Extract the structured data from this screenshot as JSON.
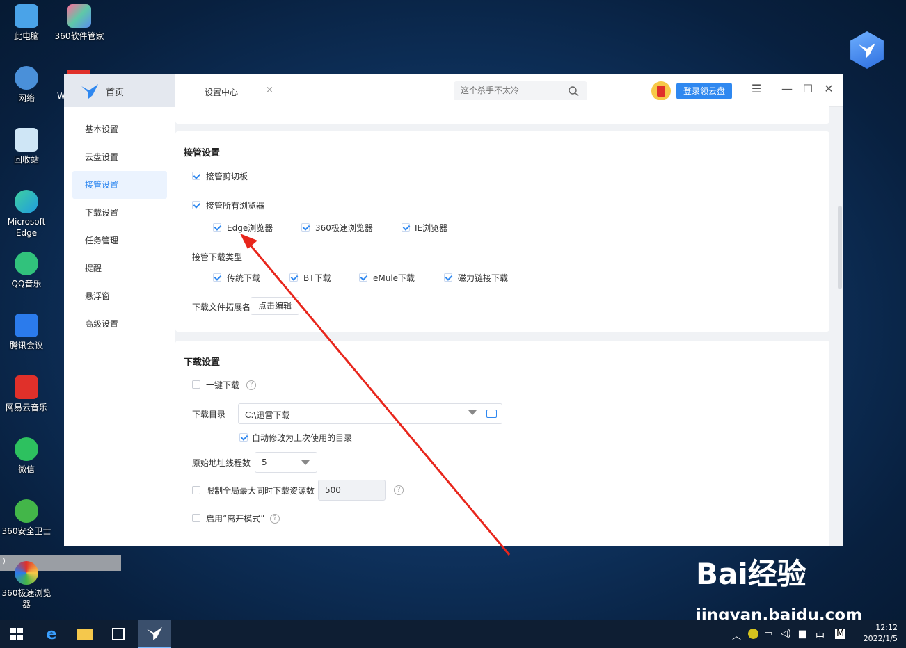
{
  "desktop_icons": [
    {
      "label": "此电脑",
      "color": "#4aa3e8"
    },
    {
      "label": "360软件管家",
      "color": "#5fc8a8"
    },
    {
      "label": "网络",
      "color": "#4a90d9"
    },
    {
      "label": "回收站",
      "color": "#9ad1f0"
    },
    {
      "label": "Microsoft Edge",
      "color": "#1f9be0"
    },
    {
      "label": "QQ音乐",
      "color": "#31c27c"
    },
    {
      "label": "腾讯会议",
      "color": "#2b7bec"
    },
    {
      "label": "网易云音乐",
      "color": "#e0302a"
    },
    {
      "label": "微信",
      "color": "#2dc15f"
    },
    {
      "label": "360安全卫士",
      "color": "#43b649"
    },
    {
      "label": "360极速浏览器",
      "color": "#e87f2a"
    }
  ],
  "desktop_fragment": "W",
  "ribbon_text": ")",
  "window": {
    "home_tab": "首页",
    "settings_tab": "设置中心",
    "search_placeholder": "这个杀手不太冷",
    "login_button": "登录领云盘",
    "sidebar": [
      "基本设置",
      "云盘设置",
      "接管设置",
      "下载设置",
      "任务管理",
      "提醒",
      "悬浮窗",
      "高级设置"
    ],
    "active_sidebar": "接管设置",
    "takeover": {
      "title": "接管设置",
      "clipboard": "接管剪切板",
      "all_browsers": "接管所有浏览器",
      "browsers": [
        "Edge浏览器",
        "360极速浏览器",
        "IE浏览器"
      ],
      "download_types_label": "接管下载类型",
      "download_types": [
        "传统下载",
        "BT下载",
        "eMule下载",
        "磁力链接下载"
      ],
      "ext_label": "下载文件拓展名",
      "ext_button": "点击编辑"
    },
    "download": {
      "title": "下载设置",
      "one_click": "一键下载",
      "dir_label": "下载目录",
      "dir_value": "C:\\迅雷下载",
      "auto_change": "自动修改为上次使用的目录",
      "threads_label": "原始地址线程数",
      "threads_value": "5",
      "limit_label": "限制全局最大同时下载资源数",
      "limit_value": "500",
      "away_mode": "启用“离开模式”"
    }
  },
  "watermark": {
    "brand": "Bai经验",
    "url": "jingyan.baidu.com"
  },
  "taskbar": {
    "time": "12:12",
    "date": "2022/1/5",
    "ime": "中",
    "ime2": "M"
  }
}
